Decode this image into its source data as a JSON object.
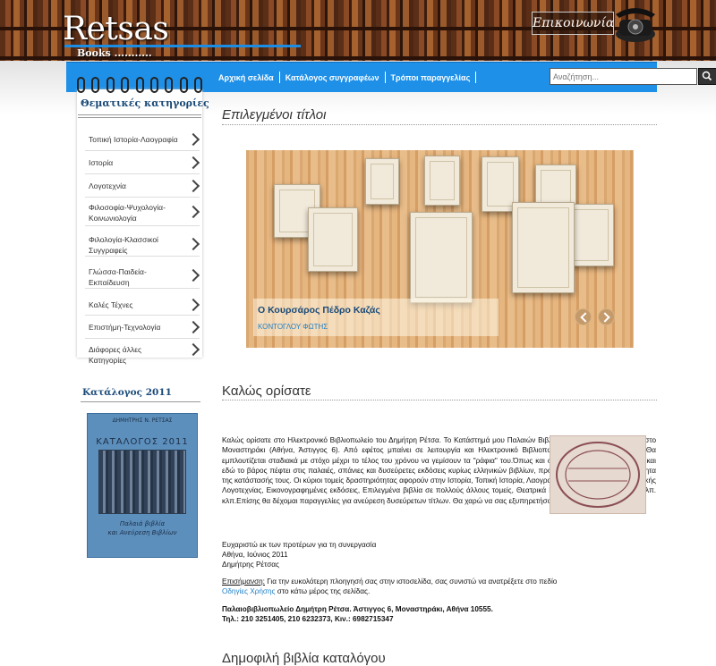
{
  "header": {
    "logo": "Retsas",
    "logo_sub": "Books",
    "contact": "Επικοινωνία"
  },
  "nav": {
    "items": [
      "Αρχική σελίδα",
      "Κατάλογος συγγραφέων",
      "Τρόποι παραγγελίας"
    ],
    "search_placeholder": "Αναζήτηση..."
  },
  "sidebar": {
    "title": "Θεματικές κατηγορίες",
    "categories": [
      [
        "Τοπική Ιστορία-Λαογραφία"
      ],
      [
        "Ιστορία"
      ],
      [
        "Λογοτεχνία"
      ],
      [
        "Φιλοσοφία-Ψυχολογία-",
        "Κοινωνιολογία"
      ],
      [
        "Φιλολογία-Κλασσικοί",
        "Συγγραφείς"
      ],
      [
        "Γλώσσα-Παιδεία-",
        "Εκπαίδευση"
      ],
      [
        "Καλές Τέχνες"
      ],
      [
        "Επιστήμη-Τεχνολογία"
      ],
      [
        "Διάφορες άλλες Κατηγορίες"
      ]
    ],
    "catalog_title": "Κατάλογος 2011",
    "catalog_cover": {
      "name": "ΔΗΜΗΤΡΗΣ Ν. ΡΕΤΣΑΣ",
      "title": "ΚΑΤΑΛΟΓΟΣ 2011",
      "subtitle_1": "Παλαιά βιβλία",
      "subtitle_2": "και Ανεύρεση Βιβλίων"
    }
  },
  "featured": {
    "title": "Επιλεγμένοι τίτλοι",
    "book_title": "Ο Κουρσάρος Πέδρο Καζάς",
    "book_author": "ΚΟΝΤΟΓΛΟΥ ΦΩΤΗΣ"
  },
  "welcome": {
    "title": "Καλώς ορίσατε",
    "body": "Καλώς ορίσατε στο Ηλεκτρονικό Βιβλιοπωλείο του Δημήτρη Ρέτσα. Το Κατάστημά μου Παλαιών Βιβλίων λειτουργεί από το 1987 στο Μοναστηράκι (Αθήνα, Άστιγγος 6). Από εφέτος μπαίνει σε λειτουργία και Ηλεκτρονικό Βιβλιοπωλείο (www.retsasbooks.gr). Θα εμπλουτίζεται σταδιακά με στόχο μέχρι το τέλος του χρόνου να γεμίσουν τα \"ράφια\" του.Όπως και στο Παλαιοβιβλιοπωλείο, έτσι και εδώ το βάρος πέφτει στις παλαιές, σπάνιες και δυσεύρετες εκδόσεις κυρίως ελληνικών βιβλίων, προσέχοντας ιδιαίτερα την ποιότητα της κατάστασής τους. Οι κύριοι τομείς δραστηριότητας αφορούν στην Ιστορία, Τοπική Ιστορία, Λαογραφία, Πρώτες εκδόσεις Ελληνικής Λογοτεχνίας, Εικονογραφημένες εκδόσεις, Επιλεγμένα βιβλία σε πολλούς άλλους τομείς, Θεατρικά Προγράμματα, Παρτιτούρες κλπ. κλπ.Επίσης θα δέχομαι παραγγελίες για ανεύρεση δυσεύρετων τίτλων. Θα χαρώ να σας εξυπηρετήσω.",
    "thanks": "Ευχαριστώ εκ των προτέρων για τη συνεργασία",
    "place_date": "Αθήνα, Ιούνιος 2011",
    "signature": "Δημήτρης Ρέτσας",
    "note_label": "Επισήμανση:",
    "note_text": " Για την ευκολότερη πλοηγησή σας στην ιστοσελίδα, σας συνιστώ να ανατρέξετε στο πεδίο",
    "note_link": "Οδηγίες Χρήσης",
    "note_tail": " στο κάτω μέρος της σελίδας.",
    "address": "Παλαιοβιβλιοπωλείο Δημήτρη Ρέτσα. Άστιγγος 6, Μοναστηράκι, Αθήνα 10555.",
    "phones": "Τηλ.: 210 3251405, 210 6232373, Κιν.: 6982715347"
  },
  "popular": {
    "title": "Δημοφιλή βιβλία καταλόγου"
  }
}
